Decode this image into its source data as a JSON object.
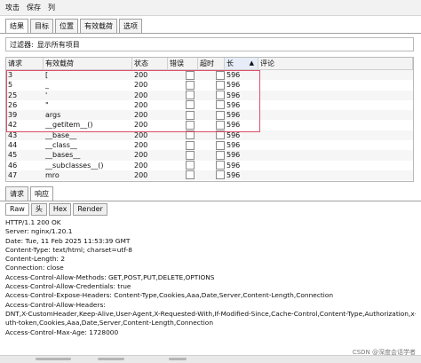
{
  "menubar": {
    "items": [
      "攻击",
      "保存",
      "列"
    ]
  },
  "tabs": [
    "结果",
    "目标",
    "位置",
    "有效载荷",
    "选项"
  ],
  "filter": {
    "label": "过滤器:",
    "value": "显示所有项目"
  },
  "table": {
    "headers": [
      "请求",
      "有效载荷",
      "状态",
      "错误",
      "超时",
      "长",
      "评论"
    ],
    "rows": [
      {
        "req": "3",
        "payload": "[",
        "status": "200",
        "len": "596"
      },
      {
        "req": "5",
        "payload": "_",
        "status": "200",
        "len": "596"
      },
      {
        "req": "25",
        "payload": "'",
        "status": "200",
        "len": "596"
      },
      {
        "req": "26",
        "payload": "\"",
        "status": "200",
        "len": "596"
      },
      {
        "req": "39",
        "payload": "args",
        "status": "200",
        "len": "596"
      },
      {
        "req": "42",
        "payload": "__getitem__()",
        "status": "200",
        "len": "596"
      },
      {
        "req": "43",
        "payload": "__base__",
        "status": "200",
        "len": "596"
      },
      {
        "req": "44",
        "payload": "__class__",
        "status": "200",
        "len": "596"
      },
      {
        "req": "45",
        "payload": "__bases__",
        "status": "200",
        "len": "596"
      },
      {
        "req": "46",
        "payload": "__subclasses__()",
        "status": "200",
        "len": "596"
      },
      {
        "req": "47",
        "payload": "mro",
        "status": "200",
        "len": "596"
      }
    ]
  },
  "subtabs": [
    "请求",
    "响应"
  ],
  "viewtabs": [
    "Raw",
    "头",
    "Hex",
    "Render"
  ],
  "response": {
    "lines": [
      "HTTP/1.1 200 OK",
      "Server: nginx/1.20.1",
      "Date: Tue, 11 Feb 2025 11:53:39 GMT",
      "Content-Type: text/html; charset=utf-8",
      "Content-Length: 2",
      "Connection: close",
      "Access-Control-Allow-Methods: GET,POST,PUT,DELETE,OPTIONS",
      "Access-Control-Allow-Credentials: true",
      "Access-Control-Expose-Headers: Content-Type,Cookies,Aaa,Date,Server,Content-Length,Connection",
      "Access-Control-Allow-Headers:",
      "DNT,X-CustomHeader,Keep-Alive,User-Agent,X-Requested-With,If-Modified-Since,Cache-Control,Content-Type,Authorization,x-a",
      "uth-token,Cookies,Aaa,Date,Server,Content-Length,Connection",
      "Access-Control-Max-Age: 1728000"
    ]
  },
  "watermark": "CSDN @深度会话学者"
}
